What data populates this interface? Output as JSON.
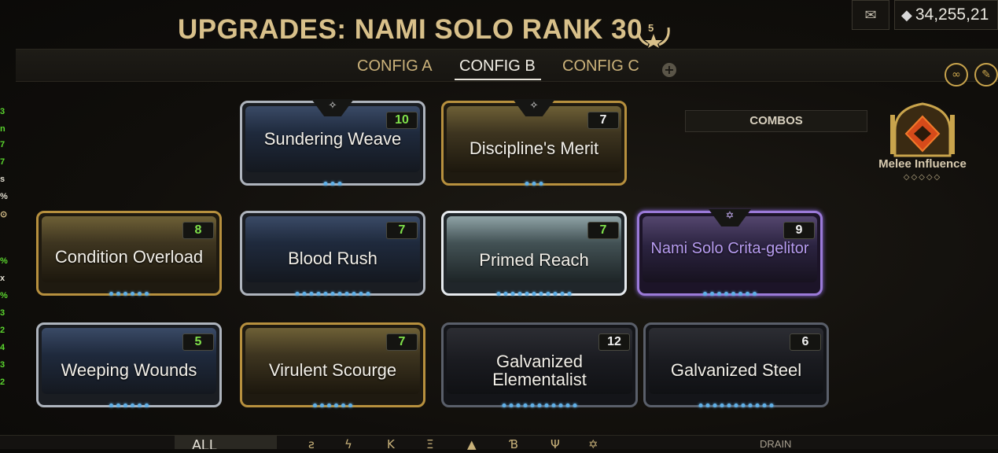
{
  "header": {
    "title": "UPGRADES: NAMI SOLO RANK 30",
    "mastery_rank": "5",
    "platinum": "34,255,21"
  },
  "tabs": {
    "items": [
      {
        "label": "CONFIG A",
        "active": false
      },
      {
        "label": "CONFIG B",
        "active": true
      },
      {
        "label": "CONFIG C",
        "active": false
      }
    ],
    "add_label": "+"
  },
  "left_strip": [
    "3",
    "n",
    "7",
    "7",
    "s",
    "%",
    "⊙",
    "%",
    "x",
    "%",
    "3",
    "2",
    "4",
    "3",
    "2"
  ],
  "combos": {
    "label": "COMBOS"
  },
  "stance": {
    "name": "Melee Influence",
    "rank_marks": "◇◇◇◇◇"
  },
  "mods": [
    {
      "name": "Sundering Weave",
      "drain": "10",
      "style": "silver",
      "polarity": "✧"
    },
    {
      "name": "Discipline's Merit",
      "drain": "7",
      "style": "gold",
      "polarity": "✧"
    },
    {
      "name": "Condition Overload",
      "drain": "8",
      "style": "gold"
    },
    {
      "name": "Blood Rush",
      "drain": "7",
      "style": "silver"
    },
    {
      "name": "Primed Reach",
      "drain": "7",
      "style": "primed"
    },
    {
      "name": "Nami Solo Crita-gelitor",
      "drain": "9",
      "style": "riven",
      "polarity": "✡"
    },
    {
      "name": "Weeping Wounds",
      "drain": "5",
      "style": "silver"
    },
    {
      "name": "Virulent Scourge",
      "drain": "7",
      "style": "gold"
    },
    {
      "name": "Galvanized Elementalist",
      "drain": "12",
      "style": "galv"
    },
    {
      "name": "Galvanized Steel",
      "drain": "6",
      "style": "galv"
    }
  ],
  "bottom": {
    "all_label": "ALL",
    "drain_label": "DRAIN"
  }
}
